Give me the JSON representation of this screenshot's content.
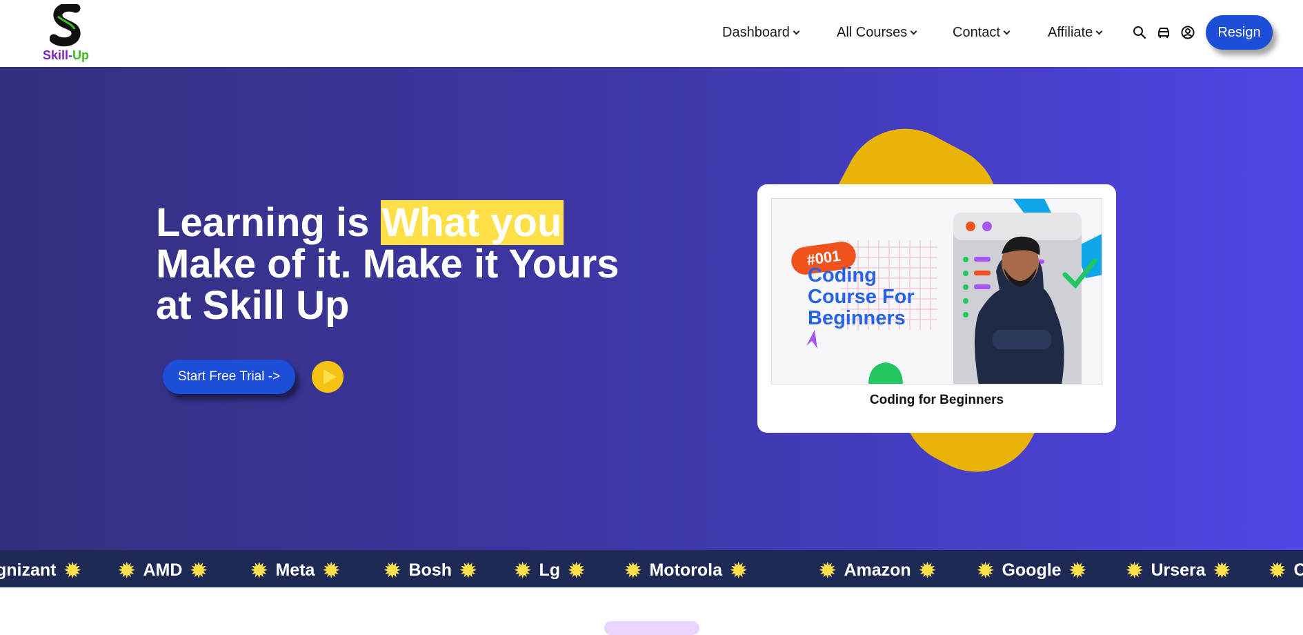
{
  "brand": {
    "name_part1": "Skill-",
    "name_part2": "Up"
  },
  "nav": {
    "items": [
      {
        "label": "Dashboard"
      },
      {
        "label": "All Courses"
      },
      {
        "label": "Contact"
      },
      {
        "label": "Affiliate"
      }
    ],
    "icons": [
      "search-icon",
      "car-icon",
      "user-circle-icon"
    ],
    "resign_label": "Resign"
  },
  "hero": {
    "headline_part1": "Learning is ",
    "headline_highlight": "What you",
    "headline_line2": "Make of it. Make it Yours",
    "headline_line3": "at Skill Up",
    "cta_label": "Start Free Trial ->",
    "card": {
      "badge": "#001",
      "thumb_title": [
        "Coding",
        "Course For",
        "Beginners"
      ],
      "caption": "Coding for Beginners"
    }
  },
  "ticker": {
    "items": [
      "gnizant",
      "AMD",
      "Meta",
      "Bosh",
      "Lg",
      "Motorola",
      "Amazon",
      "Google",
      "Ursera",
      "C"
    ]
  },
  "colors": {
    "accent": "#1d4ed8",
    "highlight": "#fde047",
    "hero_start": "#33307f",
    "hero_end": "#4f45e4",
    "ticker_bg": "#1e2a55",
    "blob": "#eab308"
  }
}
